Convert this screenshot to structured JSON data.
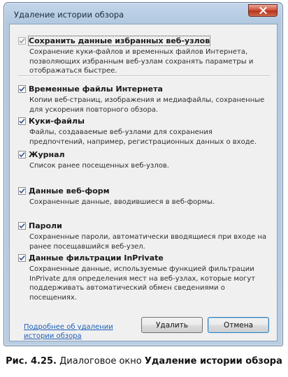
{
  "window": {
    "title": "Удаление истории обзора"
  },
  "options": [
    {
      "label": "Сохранить данные избранных веб-узлов",
      "description": "Сохранение куки-файлов и временных файлов Интернета, позволяющих избранным веб-узлам сохранять параметры и отображаться быстрее.",
      "checked": true
    },
    {
      "label": "Временные файлы Интернета",
      "description": "Копии веб-страниц, изображения и медиафайлы, сохраненные для ускорения повторного обзора.",
      "checked": true
    },
    {
      "label": "Куки-файлы",
      "description": "Файлы, создаваемые веб-узлами для сохранения предпочтений, например, регистрационных данных о входе.",
      "checked": true
    },
    {
      "label": "Журнал",
      "description": "Список ранее посещенных веб-узлов.",
      "checked": true
    },
    {
      "label": "Данные веб-форм",
      "description": "Сохраненные данные, вводившиеся в веб-формы.",
      "checked": true
    },
    {
      "label": "Пароли",
      "description": "Сохраненные пароли, автоматически вводящиеся при входе на ранее посещавшийся веб-узел.",
      "checked": true
    },
    {
      "label": "Данные фильтрации InPrivate",
      "description": "Сохраненные данные, используемые функцией фильтрации InPrivate для определения мест на веб-узлах, которые могут поддерживать автоматический обмен сведениями о посещениях.",
      "checked": true
    }
  ],
  "footer": {
    "help_link": "Подробнее об удалении истории обзора",
    "delete_label": "Удалить",
    "cancel_label": "Отмена"
  },
  "caption": {
    "figure": "Рис. 4.25.",
    "text": " Диалоговое окно ",
    "dialog_name": "Удаление истории обзора"
  },
  "colors": {
    "link": "#1d5fb8",
    "close_button": "#c8452c",
    "default_button_border": "#3c7fb1"
  }
}
